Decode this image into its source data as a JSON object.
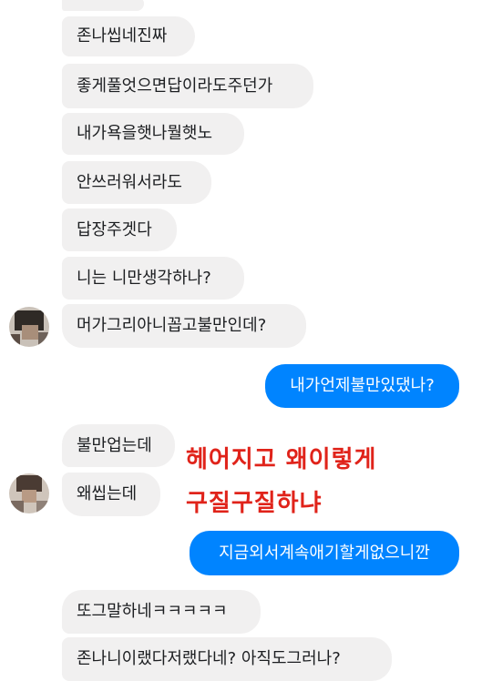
{
  "thread": {
    "group1": [
      "존나씹네진짜",
      "좋게풀엇으면답이라도주던가",
      "내가욕을햇나뭘햇노",
      "안쓰러워서라도",
      "답장주겟다",
      "니는 니만생각하나?",
      "머가그리아니꼽고불만인데?"
    ],
    "reply1": "내가언제불만있댔나?",
    "group2": [
      "불만업는데",
      "왜씹는데"
    ],
    "reply2": "지금외서계속애기할게없으니깐",
    "group3": [
      "또그말하네ㅋㅋㅋㅋㅋ",
      "존나니이랬다저랬다네? 아직도그러나?"
    ]
  },
  "overlay": {
    "line1": "헤어지고 왜이렇게",
    "line2": "구질구질하냐"
  },
  "colors": {
    "incoming_bubble": "#f1f0f0",
    "outgoing_bubble": "#0084ff",
    "overlay_text": "#e0231a"
  }
}
